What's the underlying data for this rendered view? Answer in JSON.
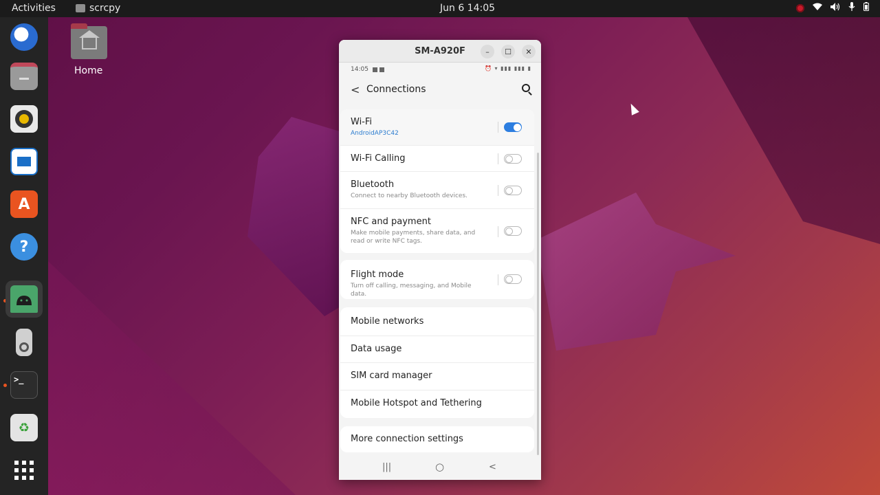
{
  "topbar": {
    "activities": "Activities",
    "app_name": "scrcpy",
    "clock": "Jun 6  14:05",
    "status_icons": [
      "record-icon",
      "wifi-icon",
      "volume-icon",
      "mic-icon",
      "battery-icon"
    ]
  },
  "dock": {
    "items": [
      "thunderbird-icon",
      "files-icon",
      "rhythmbox-icon",
      "writer-icon",
      "app-center-icon",
      "help-icon",
      "android-app-icon",
      "ipod-icon",
      "terminal-icon",
      "trash-icon",
      "show-apps-icon"
    ]
  },
  "desktop": {
    "home_label": "Home"
  },
  "window": {
    "title": "SM-A920F",
    "minimize": "–",
    "maximize": "☐",
    "close": "✕"
  },
  "phone": {
    "time": "14:05",
    "title": "Connections",
    "wifi": {
      "title": "Wi-Fi",
      "sub": "AndroidAP3C42",
      "on": true
    },
    "wifi_calling": {
      "title": "Wi-Fi Calling",
      "on": false
    },
    "bluetooth": {
      "title": "Bluetooth",
      "sub": "Connect to nearby Bluetooth devices.",
      "on": false
    },
    "nfc": {
      "title": "NFC and payment",
      "sub": "Make mobile payments, share data, and read or write NFC tags.",
      "on": false
    },
    "flight": {
      "title": "Flight mode",
      "sub": "Turn off calling, messaging, and Mobile data.",
      "on": false
    },
    "mobile_networks": "Mobile networks",
    "data_usage": "Data usage",
    "sim_manager": "SIM card manager",
    "hotspot": "Mobile Hotspot and Tethering",
    "more": "More connection settings",
    "nav": {
      "recent": "|||",
      "home": "○",
      "back": "<"
    }
  },
  "colors": {
    "accent": "#2d7ee0",
    "ubuntu_orange": "#e95420"
  }
}
